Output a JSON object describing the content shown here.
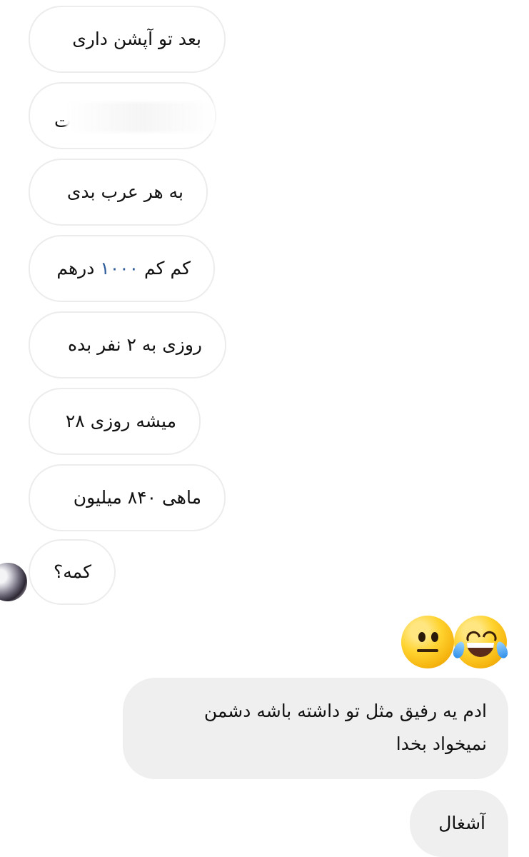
{
  "messages": {
    "incoming": [
      {
        "text": "بعد تو آپشن داری"
      },
      {
        "text": "ت"
      },
      {
        "text": "به هر عرب بدی"
      },
      {
        "text_before": "کم کم ",
        "number": "۱۰۰۰",
        "text_after": " درهم"
      },
      {
        "text": "روزی به ۲ نفر بده"
      },
      {
        "text": "میشه روزی ۲۸"
      },
      {
        "text": "ماهی ۸۴۰ میلیون"
      },
      {
        "text": "کمه؟"
      }
    ],
    "outgoing": [
      {
        "text": "ادم یه رفیق مثل تو داشته باشه دشمن نمیخواد بخدا"
      },
      {
        "text": "آشغال"
      }
    ]
  },
  "reactions": [
    {
      "icon": "neutral-face-icon",
      "label": "😐"
    },
    {
      "icon": "laughing-tears-icon",
      "label": "😂"
    }
  ],
  "colors": {
    "incoming_bubble": "#ffffff",
    "incoming_border": "#ececec",
    "outgoing_bubble": "#efefef",
    "number_highlight": "#2c5b9c"
  }
}
